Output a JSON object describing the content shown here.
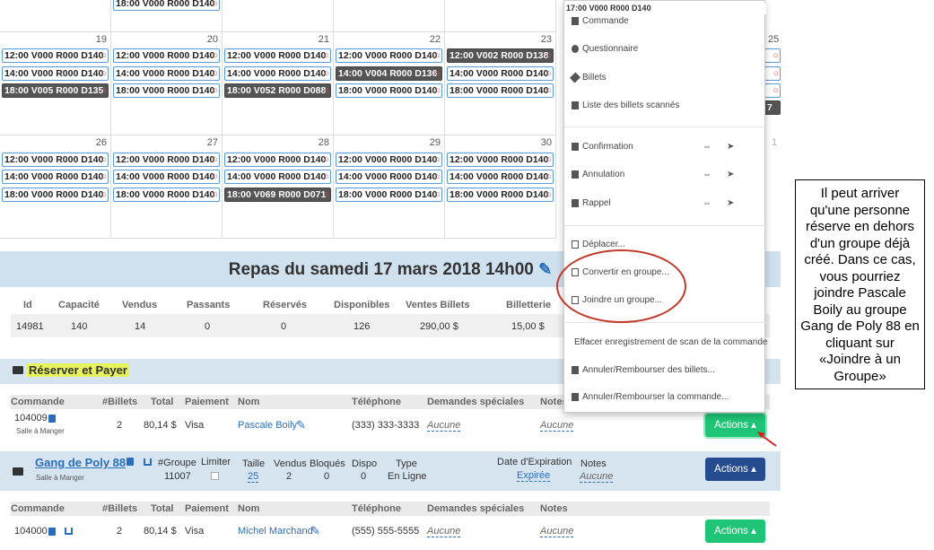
{
  "calendar": {
    "weeks": [
      {
        "days": [
          {
            "num": "19",
            "events": [
              {
                "t": "12:00 V000 R000 D140",
                "dark": false
              },
              {
                "t": "14:00 V000 R000 D140",
                "dark": false
              },
              {
                "t": "18:00 V005 R000 D135",
                "dark": true
              }
            ]
          },
          {
            "num": "20",
            "events": [
              {
                "t": "12:00 V000 R000 D140",
                "dark": false
              },
              {
                "t": "14:00 V000 R000 D140",
                "dark": false
              },
              {
                "t": "18:00 V000 R000 D140",
                "dark": false
              }
            ]
          },
          {
            "num": "21",
            "events": [
              {
                "t": "12:00 V000 R000 D140",
                "dark": false
              },
              {
                "t": "14:00 V000 R000 D140",
                "dark": false
              },
              {
                "t": "18:00 V052 R000 D088",
                "dark": true
              }
            ]
          },
          {
            "num": "22",
            "events": [
              {
                "t": "12:00 V000 R000 D140",
                "dark": false
              },
              {
                "t": "14:00 V004 R000 D136",
                "dark": true
              },
              {
                "t": "18:00 V000 R000 D140",
                "dark": false
              }
            ]
          },
          {
            "num": "23",
            "events": [
              {
                "t": "12:00 V002 R000 D138",
                "dark": true
              },
              {
                "t": "14:00 V000 R000 D140",
                "dark": false
              },
              {
                "t": "18:00 V000 R000 D140",
                "dark": false
              }
            ]
          }
        ]
      },
      {
        "days": [
          {
            "num": "26",
            "events": [
              {
                "t": "12:00 V000 R000 D140",
                "dark": false
              },
              {
                "t": "14:00 V000 R000 D140",
                "dark": false
              },
              {
                "t": "18:00 V000 R000 D140",
                "dark": false
              }
            ]
          },
          {
            "num": "27",
            "events": [
              {
                "t": "12:00 V000 R000 D140",
                "dark": false
              },
              {
                "t": "14:00 V000 R000 D140",
                "dark": false
              },
              {
                "t": "18:00 V000 R000 D140",
                "dark": false
              }
            ]
          },
          {
            "num": "28",
            "events": [
              {
                "t": "12:00 V000 R000 D140",
                "dark": false
              },
              {
                "t": "14:00 V000 R000 D140",
                "dark": false
              },
              {
                "t": "18:00 V069 R000 D071",
                "dark": true
              }
            ]
          },
          {
            "num": "29",
            "events": [
              {
                "t": "12:00 V000 R000 D140",
                "dark": false
              },
              {
                "t": "14:00 V000 R000 D140",
                "dark": false
              },
              {
                "t": "18:00 V000 R000 D140",
                "dark": false
              }
            ]
          },
          {
            "num": "30",
            "events": [
              {
                "t": "12:00 V000 R000 D140",
                "dark": false
              },
              {
                "t": "14:00 V000 R000 D140",
                "dark": false
              },
              {
                "t": "18:00 V000 R000 D140",
                "dark": false
              }
            ]
          }
        ]
      }
    ],
    "top_partial": "18:00 V000 R000 D140",
    "top_partial_right": "17:00 V000 R000 D140",
    "side_nums": [
      "25",
      "1"
    ]
  },
  "event": {
    "title": "Repas du samedi 17 mars 2018 14h00",
    "headers": [
      "Id",
      "Capacité",
      "Vendus",
      "Passants",
      "Réservés",
      "Disponibles",
      "Ventes Billets",
      "Billetterie"
    ],
    "values": [
      "14981",
      "140",
      "14",
      "0",
      "0",
      "126",
      "290,00 $",
      "15,00 $"
    ]
  },
  "reserve": {
    "title": "Réserver et Payer",
    "headers": [
      "Commande",
      "#Billets",
      "Total",
      "Paiement",
      "Nom",
      "Téléphone",
      "Demandes spéciales",
      "Notes"
    ],
    "row": {
      "commande": "104009",
      "salle": "Salle à Manger",
      "billets": "2",
      "total": "80,14 $",
      "paiement": "Visa",
      "nom": "Pascale Boily",
      "tel": "(333) 333-3333",
      "demandes": "Aucune",
      "notes": "Aucune"
    },
    "actions_label": "Actions"
  },
  "group": {
    "name": "Gang de Poly 88",
    "salle": "Salle à Manger",
    "groupe_label": "#Groupe",
    "groupe_num": "11007",
    "limiter_label": "Limiter",
    "taille_label": "Taille",
    "taille": "25",
    "vendus_label": "Vendus",
    "vendus": "2",
    "bloques_label": "Bloqués",
    "bloques": "0",
    "dispo_label": "Dispo",
    "dispo": "0",
    "type_label": "Type",
    "type": "En Ligne",
    "exp_label": "Date d'Expiration",
    "exp": "Expirée",
    "notes_label": "Notes",
    "notes": "Aucune",
    "actions_label": "Actions",
    "headers": [
      "Commande",
      "#Billets",
      "Total",
      "Paiement",
      "Nom",
      "Téléphone",
      "Demandes spéciales",
      "Notes"
    ],
    "row": {
      "commande": "104000",
      "billets": "2",
      "total": "80,14 $",
      "paiement": "Visa",
      "nom": "Michel Marchand",
      "tel": "(555) 555-5555",
      "demandes": "Aucune",
      "notes": "Aucune"
    },
    "row_actions_label": "Actions"
  },
  "menu": {
    "items": [
      {
        "key": "commande",
        "label": "Commande"
      },
      {
        "key": "questionnaire",
        "label": "Questionnaire"
      },
      {
        "key": "billets",
        "label": "Billets"
      },
      {
        "key": "liste",
        "label": "Liste des billets scannés"
      },
      {
        "key": "confirmation",
        "label": "Confirmation"
      },
      {
        "key": "annulation",
        "label": "Annulation"
      },
      {
        "key": "rappel",
        "label": "Rappel"
      },
      {
        "key": "deplacer",
        "label": "Déplacer..."
      },
      {
        "key": "convertir",
        "label": "Convertir en groupe..."
      },
      {
        "key": "joindre",
        "label": "Joindre un groupe..."
      },
      {
        "key": "effacer",
        "label": "Effacer enregistrement de scan de la commande"
      },
      {
        "key": "annuler_billets",
        "label": "Annuler/Rembourser des billets..."
      },
      {
        "key": "annuler_commande",
        "label": "Annuler/Rembourser la commande..."
      }
    ]
  },
  "annotation": "Il peut arriver qu'une personne réserve en dehors d'un groupe déjà créé. Dans ce cas, vous pourriez joindre Pascale Boily au groupe Gang de Poly 88 en cliquant sur «Joindre à un Groupe»",
  "colors": {
    "accent_green": "#1fc576",
    "accent_navy": "#244c8f",
    "highlight": "#e8f25a",
    "circle": "#c0392b"
  }
}
